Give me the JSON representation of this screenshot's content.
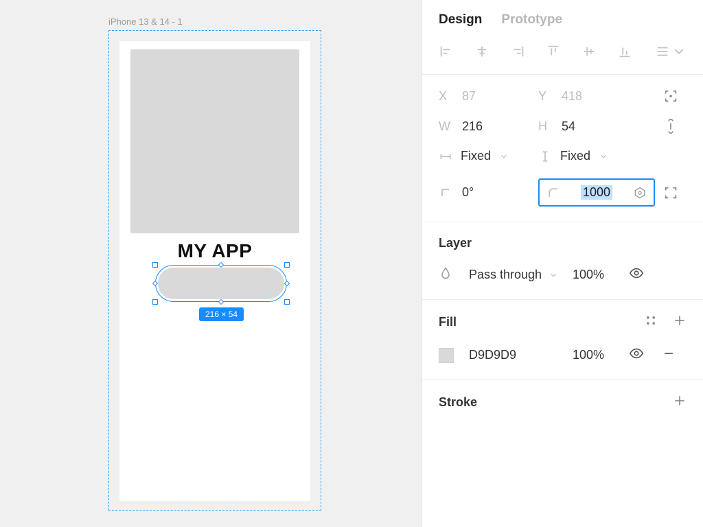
{
  "canvas": {
    "frame_label": "iPhone 13 & 14 - 1",
    "app_title": "MY APP",
    "selection_badge": "216 × 54"
  },
  "tabs": {
    "design": "Design",
    "prototype": "Prototype"
  },
  "transform": {
    "x_label": "X",
    "x_value": "87",
    "y_label": "Y",
    "y_value": "418",
    "w_label": "W",
    "w_value": "216",
    "h_label": "H",
    "h_value": "54",
    "horiz_mode": "Fixed",
    "vert_mode": "Fixed",
    "rotation": "0°",
    "radius": "1000"
  },
  "layer": {
    "title": "Layer",
    "blend_mode": "Pass through",
    "opacity": "100%"
  },
  "fill": {
    "title": "Fill",
    "color_hex": "D9D9D9",
    "opacity": "100%"
  },
  "stroke": {
    "title": "Stroke"
  }
}
